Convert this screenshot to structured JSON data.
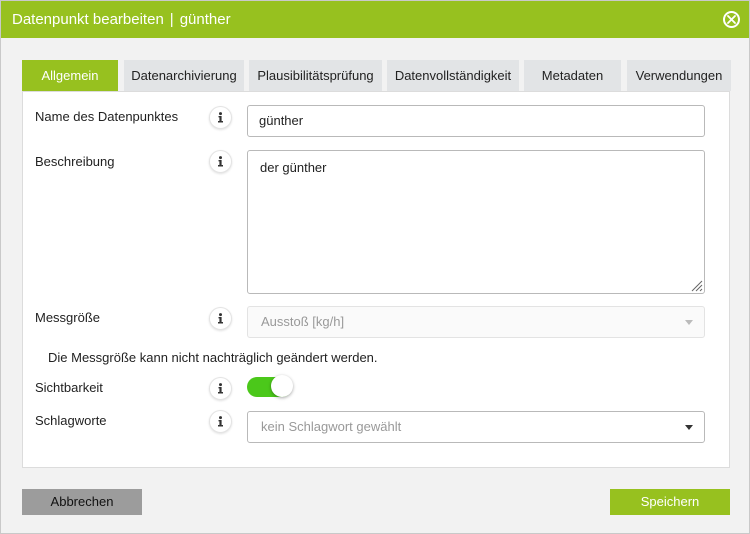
{
  "window": {
    "title": "Datenpunkt bearbeiten",
    "separator": "|",
    "subtitle": "günther"
  },
  "tabs": [
    {
      "label": "Allgemein",
      "active": true
    },
    {
      "label": "Datenarchivierung",
      "active": false
    },
    {
      "label": "Plausibilitätsprüfung",
      "active": false
    },
    {
      "label": "Datenvollständigkeit",
      "active": false
    },
    {
      "label": "Metadaten",
      "active": false
    },
    {
      "label": "Verwendungen",
      "active": false
    }
  ],
  "form": {
    "name": {
      "label": "Name des Datenpunktes",
      "value": "günther"
    },
    "description": {
      "label": "Beschreibung",
      "value": "der günther"
    },
    "measure": {
      "label": "Messgröße",
      "value": "Ausstoß [kg/h]",
      "disabled": true
    },
    "measure_note": "Die Messgröße kann nicht nachträglich geändert werden.",
    "visibility": {
      "label": "Sichtbarkeit",
      "on": true
    },
    "keywords": {
      "label": "Schlagworte",
      "placeholder": "kein Schlagwort gewählt"
    }
  },
  "buttons": {
    "cancel": "Abbrechen",
    "save": "Speichern"
  },
  "icons": {
    "close": "close-circle-icon",
    "info": "info-icon",
    "dropdown": "caret-down-icon"
  },
  "colors": {
    "accent": "#97c11f",
    "toggle_on": "#4bc81a",
    "cancel_button": "#9c9c9c",
    "tab_inactive": "#e2e4e6"
  }
}
